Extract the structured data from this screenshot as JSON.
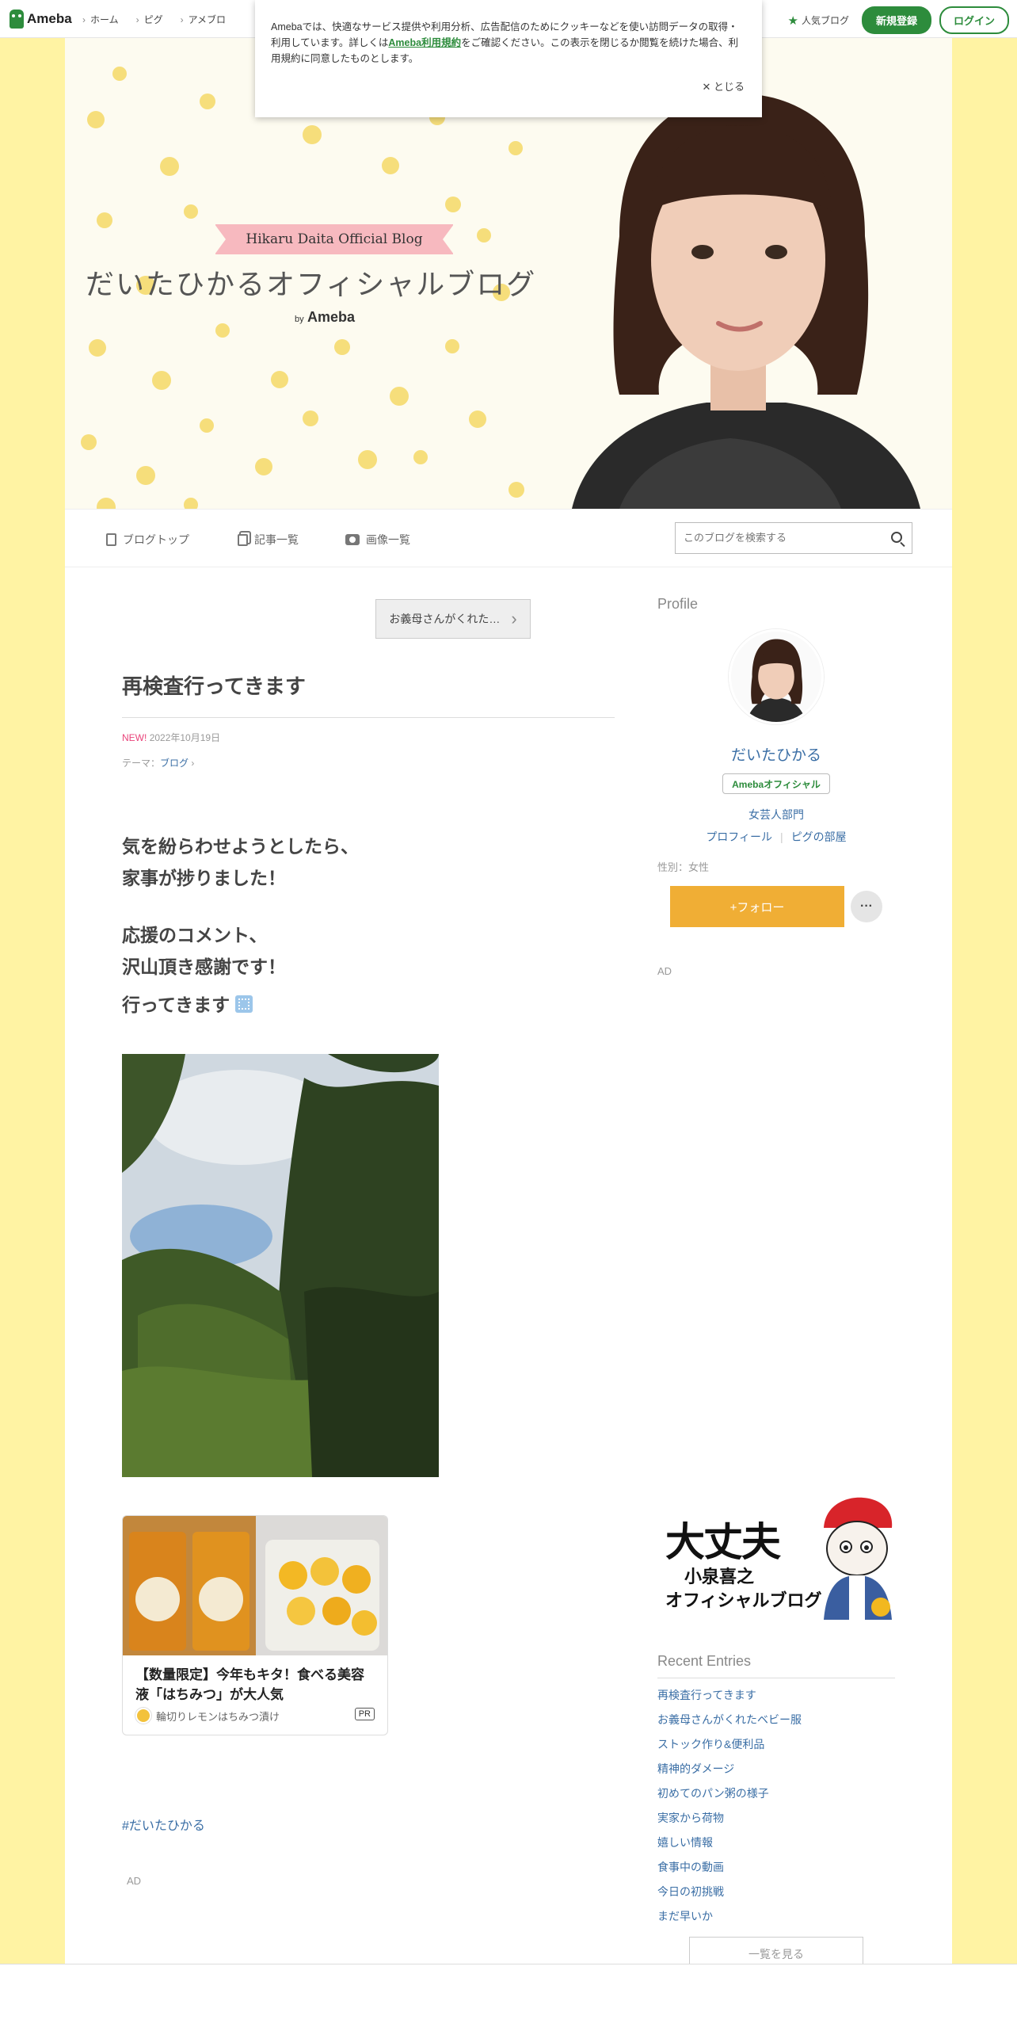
{
  "topbar": {
    "logo": "Ameba",
    "nav": [
      "ホーム",
      "ピグ",
      "アメブロ"
    ],
    "popular": "人気ブログ",
    "signup": "新規登録",
    "login": "ログイン"
  },
  "cookie": {
    "text_before": "Amebaでは、快適なサービス提供や利用分析、広告配信のためにクッキーなどを使い訪問データの取得・利用しています。詳しくは",
    "link": "Ameba利用規約",
    "text_after": "をご確認ください。この表示を閉じるか閲覧を続けた場合、利用規約に同意したものとします。",
    "close": "とじる"
  },
  "header": {
    "ribbon": "Hikaru Daita Official Blog",
    "title": "だいたひかるオフィシャルブログ",
    "by": "by",
    "brand": "Ameba"
  },
  "blognav": {
    "top": "ブログトップ",
    "entries": "記事一覧",
    "images": "画像一覧",
    "search_placeholder": "このブログを検索する"
  },
  "article": {
    "prev": "お義母さんがくれた…",
    "title": "再検査行ってきます",
    "new": "NEW!",
    "date": "2022年10月19日",
    "theme_label": "テーマ：",
    "theme": "ブログ",
    "p1_l1": "気を紛らわせようとしたら、",
    "p1_l2": "家事が捗りました！",
    "p2_l1": "応援のコメント、",
    "p2_l2": "沢山頂き感謝です！",
    "p3": "行ってきます",
    "ad_title": "【数量限定】今年もキタ！食べる美容液「はちみつ」が大人気",
    "ad_source": "輪切りレモンはちみつ漬け",
    "ad_pr": "PR",
    "hashtag": "#だいたひかる",
    "ad_label": "AD"
  },
  "sidebar": {
    "profile_heading": "Profile",
    "name": "だいたひかる",
    "official": "Amebaオフィシャル",
    "category": "女芸人部門",
    "profile_link": "プロフィール",
    "pig_link": "ピグの部屋",
    "gender": "性別：女性",
    "follow": "+フォロー",
    "more": "···",
    "ad_label": "AD",
    "banner_line1": "大丈夫",
    "banner_line2": "小泉喜之",
    "banner_line3": "オフィシャルブログ",
    "recent_heading": "Recent Entries",
    "recent": [
      "再検査行ってきます",
      "お義母さんがくれたベビー服",
      "ストック作り&便利品",
      "精神的ダメージ",
      "初めてのパン粥の様子",
      "実家から荷物",
      "嬉しい情報",
      "食事中の動画",
      "今日の初挑戦",
      "まだ早いか"
    ],
    "see_all": "一覧を見る"
  },
  "colors": {
    "accent": "#2d8c3c",
    "follow": "#f0ae35",
    "link": "#3a6ea5",
    "page_bg": "#fff3a3"
  }
}
